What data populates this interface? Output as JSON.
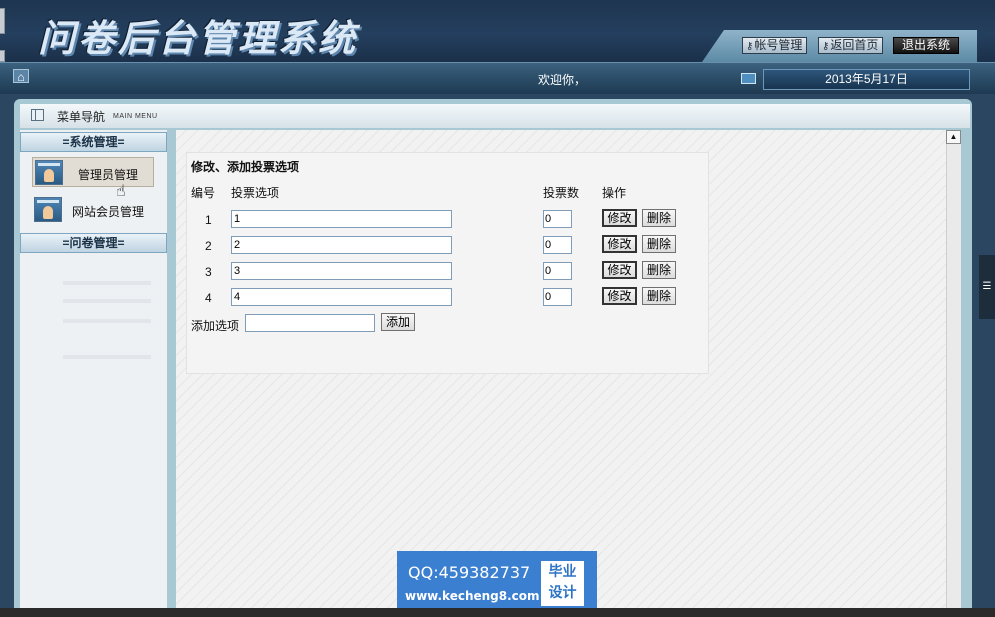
{
  "header": {
    "logo": "问卷后台管理系统",
    "buttons": {
      "account": "帐号管理",
      "home": "返回首页",
      "logout": "退出系统"
    }
  },
  "navbar": {
    "welcome": "欢迎你，",
    "date": "2013年5月17日"
  },
  "menu": {
    "title": "菜单导航",
    "subtitle": "MAIN MENU"
  },
  "sidebar": {
    "sections": [
      {
        "title": "=系统管理=",
        "items": [
          "管理员管理",
          "网站会员管理"
        ]
      },
      {
        "title": "=问卷管理="
      }
    ]
  },
  "panel": {
    "title": "修改、添加投票选项",
    "columns": {
      "id": "编号",
      "option": "投票选项",
      "votes": "投票数",
      "action": "操作"
    },
    "rows": [
      {
        "num": "1",
        "option": "1",
        "votes": "0"
      },
      {
        "num": "2",
        "option": "2",
        "votes": "0"
      },
      {
        "num": "3",
        "option": "3",
        "votes": "0"
      },
      {
        "num": "4",
        "option": "4",
        "votes": "0"
      }
    ],
    "edit_label": "修改",
    "delete_label": "删除",
    "add_label": "添加选项",
    "add_button": "添加",
    "add_value": ""
  },
  "watermark": {
    "qq": "QQ:459382737",
    "url": "www.kecheng8.com",
    "badge_line1": "毕业",
    "badge_line2": "设计"
  },
  "colors": {
    "header_bg": "#243f5e",
    "frame_bg": "#a8c8d4",
    "watermark_bg": "#3b7fd1"
  }
}
